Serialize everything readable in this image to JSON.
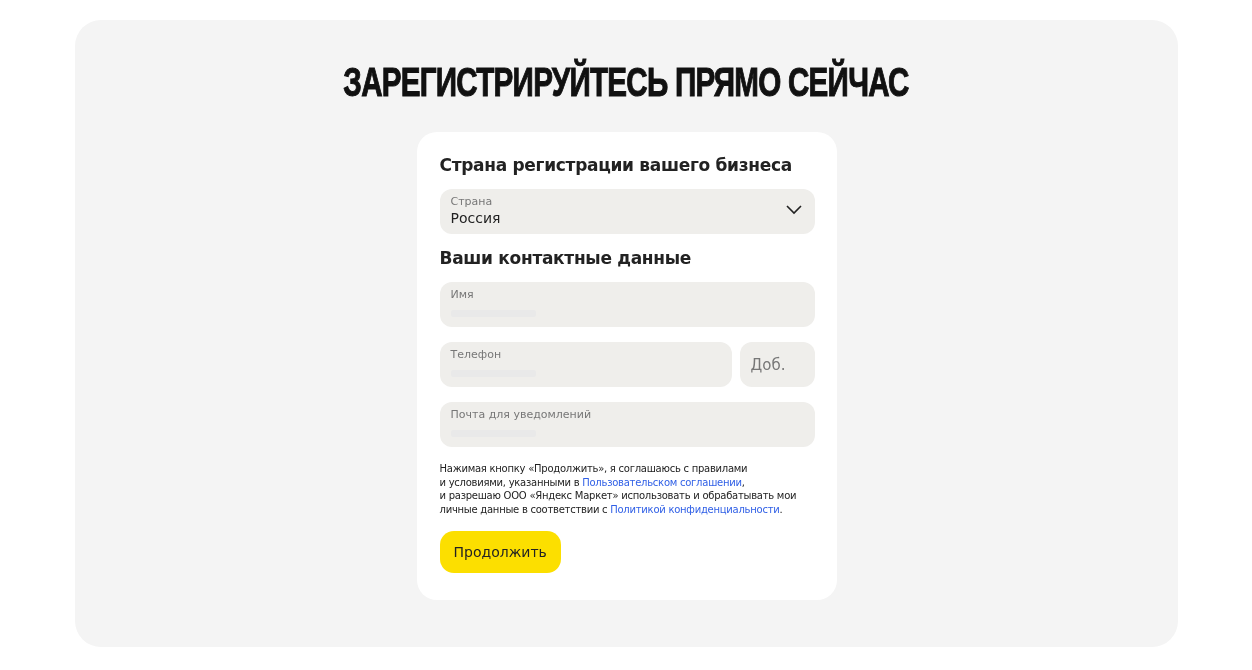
{
  "title": "ЗАРЕГИСТРИРУЙТЕСЬ ПРЯМО СЕЙЧАС",
  "country_section": {
    "heading": "Страна регистрации вашего бизнеса",
    "field": {
      "kind": "select",
      "label": "Страна",
      "value": "Россия"
    }
  },
  "contact_section": {
    "heading": "Ваши контактные данные",
    "rows": [
      [
        {
          "kind": "text",
          "label": "Имя"
        }
      ],
      [
        {
          "kind": "text",
          "label": "Телефон"
        },
        {
          "kind": "short",
          "placeholder": "Доб."
        }
      ],
      [
        {
          "kind": "text",
          "label": "Почта для уведомлений"
        }
      ]
    ]
  },
  "consent": {
    "lines": [
      [
        {
          "kind": "text",
          "text": "Нажимая кнопку «Продолжить», я соглашаюсь с правилами"
        }
      ],
      [
        {
          "kind": "text",
          "text": "и условиями, указанными в "
        },
        {
          "kind": "link",
          "text": "Пользовательском соглашении"
        },
        {
          "kind": "text",
          "text": ","
        }
      ],
      [
        {
          "kind": "text",
          "text": "и разрешаю ООО «Яндекс Маркет» использовать и обрабатывать мои"
        }
      ],
      [
        {
          "kind": "text",
          "text": "личные данные в соответствии с "
        },
        {
          "kind": "link",
          "text": "Политикой конфиденциальности"
        },
        {
          "kind": "text",
          "text": "."
        }
      ]
    ]
  },
  "submit_button": "Продолжить"
}
